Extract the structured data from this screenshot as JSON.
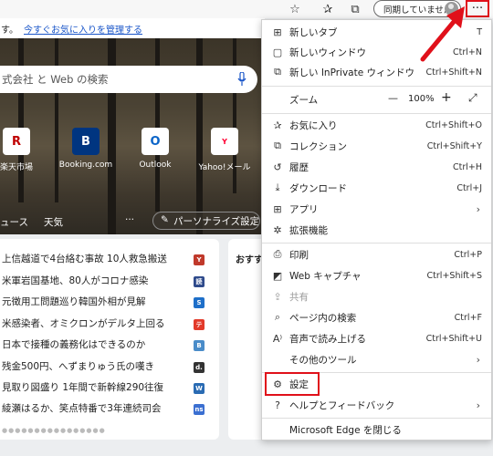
{
  "toolbar": {
    "sync_label": "同期していません",
    "more_label": "···",
    "icons": [
      "favorite-add-icon",
      "favorites-icon",
      "collections-icon",
      "profile-icon",
      "more-icon"
    ]
  },
  "favbar": {
    "prefix": "す。",
    "link": "今すぐお気に入りを管理する"
  },
  "search": {
    "placeholder": "式会社 と Web の検索"
  },
  "tiles": [
    {
      "label": "楽天市場",
      "glyph": "R",
      "color": "#bf0000"
    },
    {
      "label": "Booking.com",
      "glyph": "B",
      "color": "#003580"
    },
    {
      "label": "Outlook",
      "glyph": "O",
      "color": "#0a64c8"
    },
    {
      "label": "Yahoo!メール",
      "glyph": "Y",
      "color": "#ff0033"
    }
  ],
  "newsnav": {
    "tab1": "ュース",
    "tab2": "天気",
    "more": "···",
    "personalize": "パーソナライズ設定"
  },
  "news": [
    {
      "text": "上信越道で4台絡む事故 10人救急搬送",
      "badge_color": "#c0392b",
      "badge": "Y"
    },
    {
      "text": "米軍岩国基地、80人がコロナ感染",
      "badge_color": "#2e4a8b",
      "badge": "読"
    },
    {
      "text": "元徴用工問題巡り韓国外相が見解",
      "badge_color": "#1e6fc9",
      "badge": "S"
    },
    {
      "text": "米感染者、オミクロンがデルタ上回る",
      "badge_color": "#e23a2a",
      "badge": "テ"
    },
    {
      "text": "日本で接種の義務化はできるのか",
      "badge_color": "#4a8cc9",
      "badge": "B"
    },
    {
      "text": "残金500円、へずまりゅう氏の嘆き",
      "badge_color": "#333333",
      "badge": "d."
    },
    {
      "text": "見取り図盛り 1年間で新幹線290往復",
      "badge_color": "#2a6bb3",
      "badge": "W"
    },
    {
      "text": "綾瀬はるか、笑点特番で3年連続司会",
      "badge_color": "#3b6fd1",
      "badge": "ns"
    }
  ],
  "side_card_title": "おすす",
  "menu": {
    "new_tab": {
      "label": "新しいタブ",
      "shortcut": "T"
    },
    "new_window": {
      "label": "新しいウィンドウ",
      "shortcut": "Ctrl+N"
    },
    "new_private": {
      "label": "新しい InPrivate ウィンドウ",
      "shortcut": "Ctrl+Shift+N"
    },
    "zoom": {
      "label": "ズーム",
      "value": "100%",
      "minus": "—",
      "plus": "+"
    },
    "favorites": {
      "label": "お気に入り",
      "shortcut": "Ctrl+Shift+O"
    },
    "collections": {
      "label": "コレクション",
      "shortcut": "Ctrl+Shift+Y"
    },
    "history": {
      "label": "履歴",
      "shortcut": "Ctrl+H"
    },
    "downloads": {
      "label": "ダウンロード",
      "shortcut": "Ctrl+J"
    },
    "apps": {
      "label": "アプリ"
    },
    "extensions": {
      "label": "拡張機能"
    },
    "print": {
      "label": "印刷",
      "shortcut": "Ctrl+P"
    },
    "web_capture": {
      "label": "Web キャプチャ",
      "shortcut": "Ctrl+Shift+S"
    },
    "share": {
      "label": "共有"
    },
    "find": {
      "label": "ページ内の検索",
      "shortcut": "Ctrl+F"
    },
    "read_aloud": {
      "label": "音声で読み上げる",
      "shortcut": "Ctrl+Shift+U"
    },
    "more_tools": {
      "label": "その他のツール"
    },
    "settings": {
      "label": "設定"
    },
    "help": {
      "label": "ヘルプとフィードバック"
    },
    "close": {
      "label": "Microsoft Edge を閉じる"
    }
  },
  "colors": {
    "highlight": "#e0101a",
    "link": "#1a56c9"
  }
}
